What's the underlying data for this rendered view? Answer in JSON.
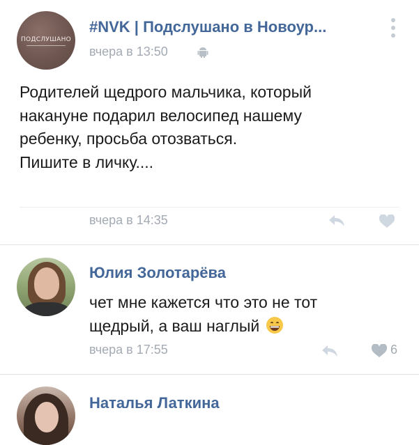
{
  "post": {
    "group_name": "#NVK | Подслушано в Новоур...",
    "avatar_text": "ПОДСЛУШАНО",
    "time": "вчера в 13:50",
    "text_lines": [
      "Родителей щедрого мальчика, который",
      "накануне подарил велосипед нашему",
      "ребенку, просьба отозваться.",
      "Пишите в личку...."
    ],
    "footer_time": "вчера в 14:35"
  },
  "comments": [
    {
      "author": "Юлия Золотарёва",
      "text_lines": [
        "чет мне кажется что это не тот",
        "щедрый, а ваш наглый"
      ],
      "emoji": "grinning-face",
      "time": "вчера в 17:55",
      "likes": "6"
    },
    {
      "author": "Наталья Латкина"
    }
  ],
  "colors": {
    "link": "#44679a",
    "meta": "#a4aab3",
    "text": "#1b1b1b",
    "icon": "#cfd7e0"
  },
  "icons": [
    "android-icon",
    "more-icon",
    "reply-icon",
    "heart-icon",
    "grinning-face-emoji"
  ]
}
